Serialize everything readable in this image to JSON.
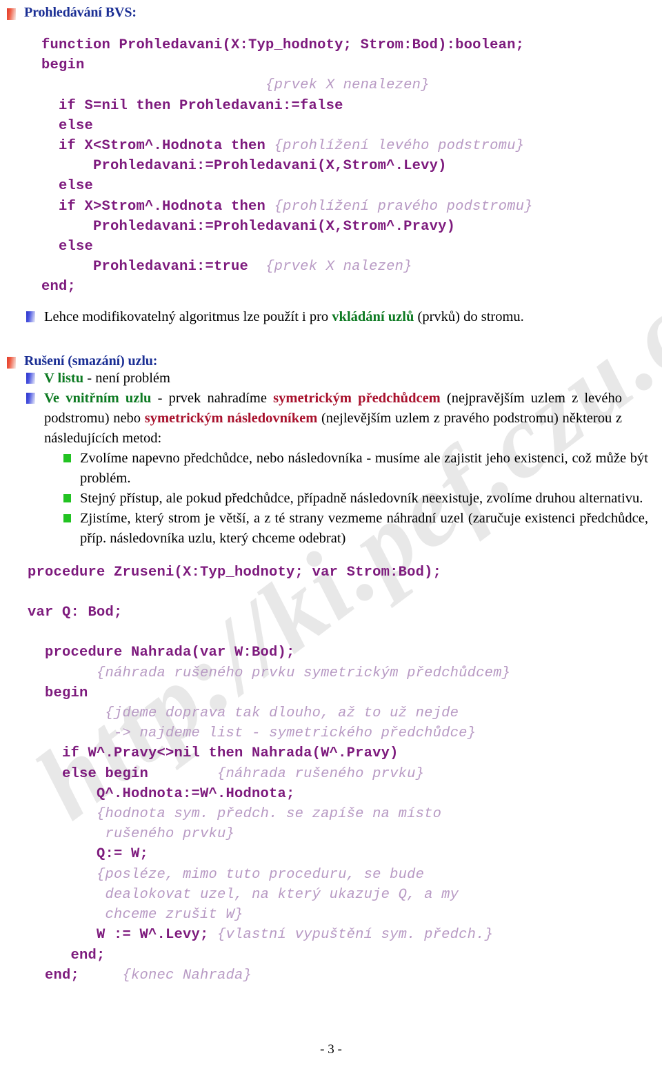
{
  "watermark": {
    "text": "http://ki.pef.czu.cz/Elvys"
  },
  "headings": {
    "search": "Prohledávání BVS:",
    "delete": "Rušení (smazání) uzlu:"
  },
  "code_block_1": {
    "lines": [
      {
        "segments": [
          {
            "t": "function Prohledavani(X:Typ_hodnoty; Strom:Bod):boolean;",
            "k": "code"
          }
        ]
      },
      {
        "segments": [
          {
            "t": "begin",
            "k": "code"
          }
        ]
      },
      {
        "segments": [
          {
            "t": "                          ",
            "k": "code"
          },
          {
            "t": "{prvek X nenalezen}",
            "k": "comment"
          }
        ]
      },
      {
        "segments": [
          {
            "t": "  if S=nil then Prohledavani:=false",
            "k": "code"
          }
        ]
      },
      {
        "segments": [
          {
            "t": "  else",
            "k": "code"
          }
        ]
      },
      {
        "segments": [
          {
            "t": "  if X<Strom^.Hodnota then ",
            "k": "code"
          },
          {
            "t": "{prohlížení levého podstromu}",
            "k": "comment"
          }
        ]
      },
      {
        "segments": [
          {
            "t": "      Prohledavani:=Prohledavani(X,Strom^.Levy)",
            "k": "code"
          }
        ]
      },
      {
        "segments": [
          {
            "t": "  else",
            "k": "code"
          }
        ]
      },
      {
        "segments": [
          {
            "t": "  if X>Strom^.Hodnota then ",
            "k": "code"
          },
          {
            "t": "{prohlížení pravého podstromu}",
            "k": "comment"
          }
        ]
      },
      {
        "segments": [
          {
            "t": "      Prohledavani:=Prohledavani(X,Strom^.Pravy)",
            "k": "code"
          }
        ]
      },
      {
        "segments": [
          {
            "t": "  else",
            "k": "code"
          }
        ]
      },
      {
        "segments": [
          {
            "t": "      Prohledavani:=true  ",
            "k": "code"
          },
          {
            "t": "{prvek X nalezen}",
            "k": "comment"
          }
        ]
      },
      {
        "segments": [
          {
            "t": "end;",
            "k": "code"
          }
        ]
      }
    ]
  },
  "note": {
    "parts": [
      {
        "t": "Lehce modifikovatelný algoritmus lze použít i pro ",
        "k": "plain"
      },
      {
        "t": "vkládání uzlů",
        "k": "green"
      },
      {
        "t": " (prvků) do stromu.",
        "k": "plain"
      }
    ]
  },
  "delete_items": [
    {
      "parts": [
        {
          "t": "V listu",
          "k": "green"
        },
        {
          "t": " - není problém",
          "k": "plain"
        }
      ]
    },
    {
      "parts": [
        {
          "t": "Ve vnitřním uzlu",
          "k": "green"
        },
        {
          "t": " - prvek nahradíme ",
          "k": "plain"
        },
        {
          "t": "symetrickým předchůdcem",
          "k": "maroon"
        },
        {
          "t": " (nejpravějším uzlem z levého podstromu) nebo ",
          "k": "plain"
        },
        {
          "t": "symetrickým následovníkem",
          "k": "maroon"
        },
        {
          "t": " (nejlevějším uzlem z pravého podstromu) některou z následujících metod:",
          "k": "plain"
        }
      ]
    }
  ],
  "methods": [
    {
      "text": "Zvolíme napevno předchůdce, nebo následovníka - musíme ale zajistit jeho existenci, což může být problém."
    },
    {
      "text": "Stejný přístup, ale pokud předchůdce, případně následovník neexistuje, zvolíme druhou alternativu."
    },
    {
      "text": "Zjistíme, který strom je větší, a z té strany vezmeme náhradní uzel (zaručuje existenci předchůdce, příp. následovníka uzlu, který chceme odebrat)"
    }
  ],
  "code_block_2": {
    "lines": [
      {
        "segments": [
          {
            "t": "procedure Zruseni(X:Typ_hodnoty; var Strom:Bod);",
            "k": "code"
          }
        ]
      },
      {
        "segments": [
          {
            "t": " ",
            "k": "code"
          }
        ]
      },
      {
        "segments": [
          {
            "t": "var Q: Bod;",
            "k": "code"
          }
        ]
      },
      {
        "segments": [
          {
            "t": " ",
            "k": "code"
          }
        ]
      },
      {
        "segments": [
          {
            "t": "  procedure Nahrada(var W:Bod);",
            "k": "code"
          }
        ]
      },
      {
        "segments": [
          {
            "t": "        ",
            "k": "code"
          },
          {
            "t": "{náhrada rušeného prvku symetrickým předchůdcem}",
            "k": "comment"
          }
        ]
      },
      {
        "segments": [
          {
            "t": "  begin",
            "k": "code"
          }
        ]
      },
      {
        "segments": [
          {
            "t": "         ",
            "k": "code"
          },
          {
            "t": "{jdeme doprava tak dlouho, až to už nejde",
            "k": "comment"
          }
        ]
      },
      {
        "segments": [
          {
            "t": "          ",
            "k": "code"
          },
          {
            "t": "-> najdeme list - symetrického předchůdce}",
            "k": "comment"
          }
        ]
      },
      {
        "segments": [
          {
            "t": "    if W^.Pravy<>nil then Nahrada(W^.Pravy)",
            "k": "code"
          }
        ]
      },
      {
        "segments": [
          {
            "t": "    else begin        ",
            "k": "code"
          },
          {
            "t": "{náhrada rušeného prvku}",
            "k": "comment"
          }
        ]
      },
      {
        "segments": [
          {
            "t": "        Q^.Hodnota:=W^.Hodnota;",
            "k": "code"
          }
        ]
      },
      {
        "segments": [
          {
            "t": "        ",
            "k": "code"
          },
          {
            "t": "{hodnota sym. předch. se zapíše na místo",
            "k": "comment"
          }
        ]
      },
      {
        "segments": [
          {
            "t": "         ",
            "k": "code"
          },
          {
            "t": "rušeného prvku}",
            "k": "comment"
          }
        ]
      },
      {
        "segments": [
          {
            "t": "        Q:= W;",
            "k": "code"
          }
        ]
      },
      {
        "segments": [
          {
            "t": "        ",
            "k": "code"
          },
          {
            "t": "{posléze, mimo tuto proceduru, se bude",
            "k": "comment"
          }
        ]
      },
      {
        "segments": [
          {
            "t": "         ",
            "k": "code"
          },
          {
            "t": "dealokovat uzel, na který ukazuje Q, a my",
            "k": "comment"
          }
        ]
      },
      {
        "segments": [
          {
            "t": "         ",
            "k": "code"
          },
          {
            "t": "chceme zrušit W}",
            "k": "comment"
          }
        ]
      },
      {
        "segments": [
          {
            "t": "        W := W^.Levy; ",
            "k": "code"
          },
          {
            "t": "{vlastní vypuštění sym. předch.}",
            "k": "comment"
          }
        ]
      },
      {
        "segments": [
          {
            "t": "     end;",
            "k": "code"
          }
        ]
      },
      {
        "segments": [
          {
            "t": "  end;     ",
            "k": "code"
          },
          {
            "t": "{konec Nahrada}",
            "k": "comment"
          }
        ]
      }
    ]
  },
  "footer": {
    "page_label": "- 3 -"
  },
  "colors": {
    "heading": "#1a2e94",
    "code": "#7d1a7d",
    "comment": "#b89ac4",
    "green": "#0d7a22",
    "maroon": "#a8112c",
    "bullet_red": "#e03b2a",
    "bullet_blue": "#2a32c8",
    "bullet_green": "#22c322"
  }
}
